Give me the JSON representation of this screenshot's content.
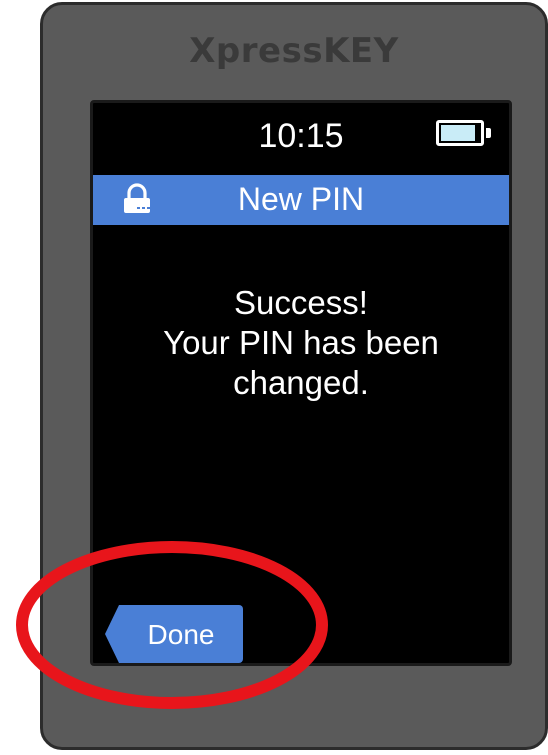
{
  "device": {
    "brand": "XpressKEY"
  },
  "status_bar": {
    "time": "10:15",
    "battery_icon": "battery-icon",
    "battery_level": 0.85
  },
  "title_bar": {
    "icon": "padlock-icon",
    "title": "New PIN"
  },
  "message": {
    "line1": "Success!",
    "line2": "Your PIN has been",
    "line3": "changed."
  },
  "actions": {
    "done_label": "Done"
  },
  "colors": {
    "device_body": "#5a5a5a",
    "screen": "#000000",
    "title_bar": "#4a7fd6",
    "button": "#4a7fd6",
    "highlight_ring": "#e8151b",
    "battery_fill": "#c9ecf7"
  }
}
